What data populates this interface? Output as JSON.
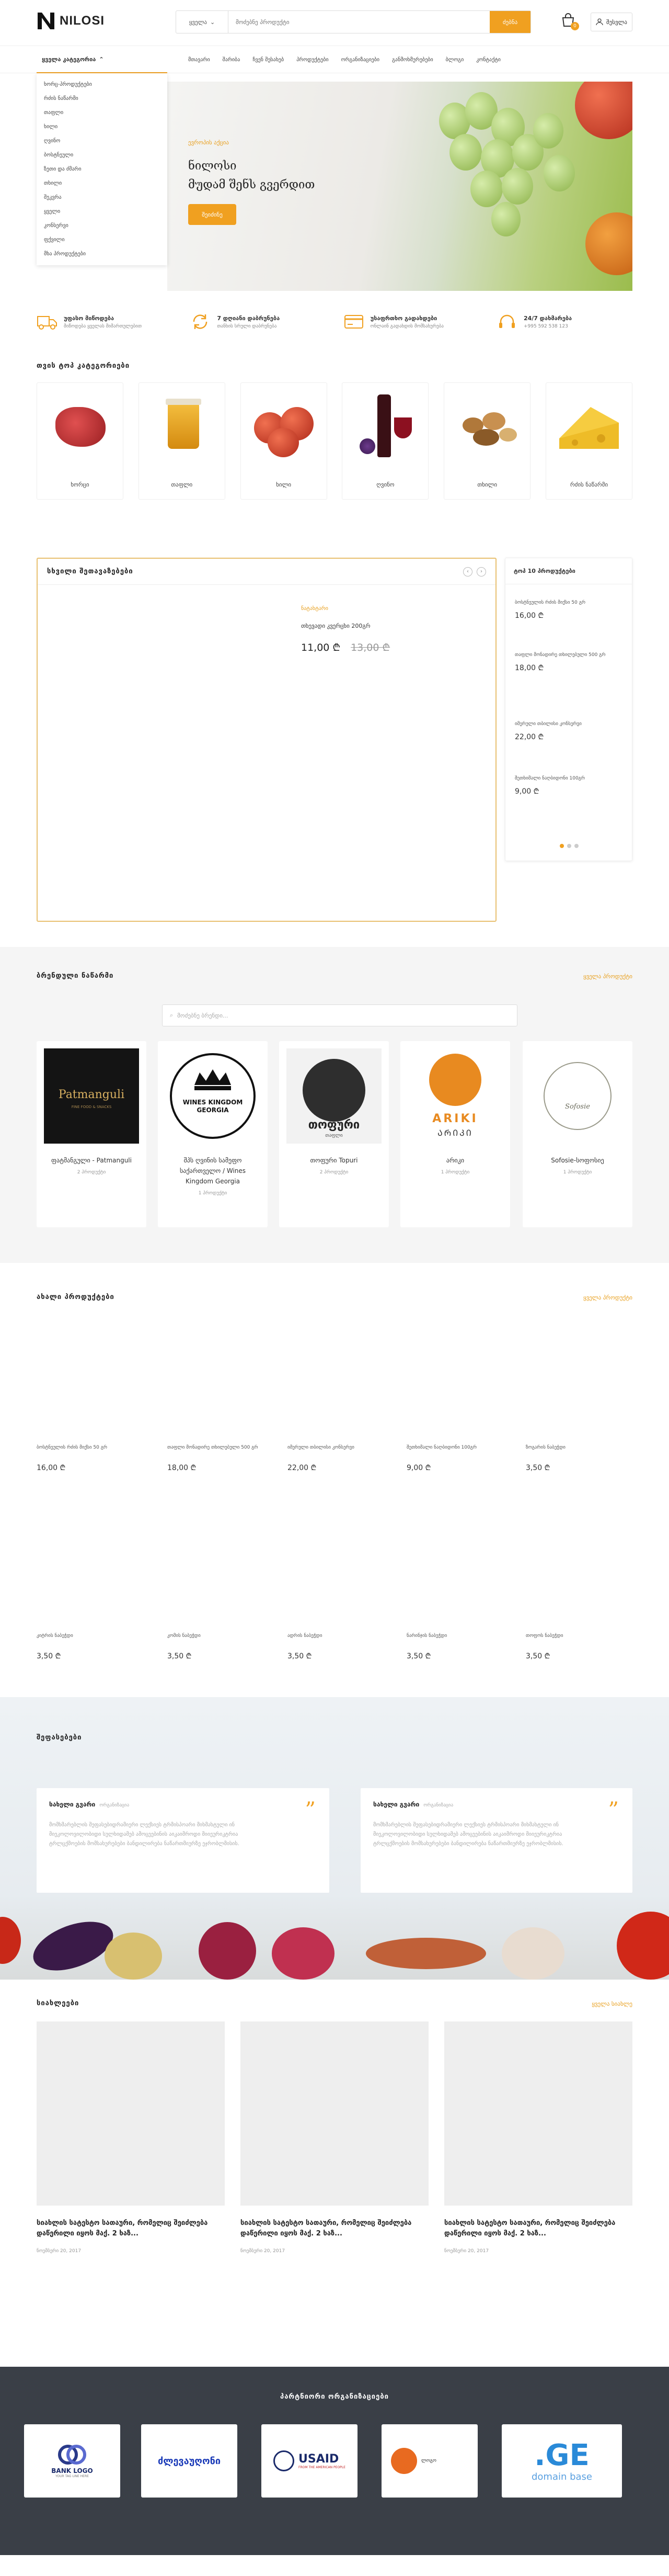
{
  "header": {
    "logo_text": "NILOSI",
    "search": {
      "select_label": "ყველა",
      "placeholder": "მოძებნე პროდუქტი",
      "button": "ძებნა"
    },
    "cart_count": "0",
    "login_label": "შესვლა",
    "accent": "#f0a020"
  },
  "nav": {
    "categories_button": "ყველა კატეგორია",
    "links": [
      "მთავარი",
      "შარიბა",
      "ჩვენ შესახებ",
      "პროდუქტები",
      "ორგანიზაციები",
      "განმოხმურებები",
      "ბლოგი",
      "კონტაქტი"
    ],
    "category_menu": [
      "ხორც-პროდუქტები",
      "რძის ნაწარმი",
      "თაფლი",
      "ხილი",
      "ღვინო",
      "ბოსტნეული",
      "ზეთი და ძმარი",
      "თხილი",
      "შეკვრა",
      "ყველი",
      "კონსერვი",
      "ფქვილი",
      "მხა პროდუქტები"
    ]
  },
  "hero": {
    "subtitle": "ევროპის აქცია",
    "title_line1": "ნილოსი",
    "title_line2": "მუდამ შენს გვერდით",
    "button": "შეიძინე"
  },
  "features": [
    {
      "title": "უფასო მიწოდება",
      "sub": "მიწოდება ყველას მიმართულებით",
      "icon": "truck-icon"
    },
    {
      "title": "7 დღიანი დაბრუნება",
      "sub": "თანხის სრული დაბრუნება",
      "icon": "return-icon"
    },
    {
      "title": "უსაფრთხო გადახდები",
      "sub": "ონლაინ გადახდის მომსახურება",
      "icon": "card-icon"
    },
    {
      "title": "24/7 დახმარება",
      "sub": "+995 592 538 123",
      "icon": "headset-icon"
    }
  ],
  "categories": {
    "title": "თვის ტოპ კატეგორიები",
    "items": [
      "ხორცი",
      "თაფლი",
      "ხილი",
      "ღვინო",
      "თხილი",
      "რძის ნაწარმი"
    ]
  },
  "deal": {
    "title": "სხვილი შეთავაზებები",
    "brand": "ნატახტარი",
    "name": "თხევადი კვერცხი 200გრ",
    "price": "11,00 ₾",
    "old_price": "13,00 ₾",
    "prev": "‹",
    "next": "›"
  },
  "top10": {
    "title": "ტოპ 10 პროდუქტები",
    "items": [
      {
        "name": "ბოსტნეულის რძის მიქსი 50 გრ",
        "price": "16,00 ₾"
      },
      {
        "name": "თაფლი მონადირე თხილებული 500 გრ",
        "price": "18,00 ₾"
      },
      {
        "name": "იმერული თბილისი კონსერვი",
        "price": "22,00 ₾"
      },
      {
        "name": "შეთხიმალი ნაღბიდონი 100გრ",
        "price": "9,00 ₾"
      }
    ]
  },
  "brands": {
    "title": "ბრენდული ნაწარმი",
    "view_all": "ყველა პროდუქტი",
    "search_placeholder": "მოძებნე ბრენდი...",
    "items": [
      {
        "name": "ფატმანგული - Patmanguli",
        "count": "2 პროდუქტი",
        "logo_text": "Patmanguli",
        "logo_sub": "FINE FOOD & SNACKS"
      },
      {
        "name": "შპს ღვინის სამეფო საქართველო / Wines Kingdom Georgia",
        "count": "1 პროდუქტი",
        "logo_text": "WINES KINGDOM GEORGIA"
      },
      {
        "name": "თოფური Topuri",
        "count": "2 პროდუქტი",
        "logo_text": "თოფური",
        "logo_sub": "თაფლი"
      },
      {
        "name": "არიკი",
        "count": "1 პროდუქტი",
        "logo_text": "ARIKI",
        "logo_sub": "ᲐᲠᲘᲙᲘ"
      },
      {
        "name": "Sofosie-სოფოსიე",
        "count": "1 პროდუქტი",
        "logo_text": "Sofosie"
      }
    ]
  },
  "new_products": {
    "title": "ახალი პროდუქტები",
    "view_all": "ყველა პროდუქტი",
    "row1": [
      {
        "name": "ბოსტნეულის რძის მიქსი 50 გრ",
        "price": "16,00 ₾"
      },
      {
        "name": "თაფლი მონადირე თხილებული 500 გრ",
        "price": "18,00 ₾"
      },
      {
        "name": "იმერული თბილისი კონსერვი",
        "price": "22,00 ₾"
      },
      {
        "name": "შეთხიმალი ნაღბიდონი 100გრ",
        "price": "9,00 ₾"
      },
      {
        "name": "ზოგარის ნაბეჭდი",
        "price": "3,50 ₾"
      }
    ],
    "row2": [
      {
        "name": "კიტრის ნაბეჭდი",
        "price": "3,50 ₾"
      },
      {
        "name": "კომის ნაბეჭდი",
        "price": "3,50 ₾"
      },
      {
        "name": "ადრის ნაბეჭდი",
        "price": "3,50 ₾"
      },
      {
        "name": "ნარინჯის ნაბეჭდი",
        "price": "3,50 ₾"
      },
      {
        "name": "თოფოს ნაბეჭდი",
        "price": "3,50 ₾"
      }
    ]
  },
  "testimonials": {
    "title": "შეფასებები",
    "items": [
      {
        "name": "სახელი გვარი",
        "role": "ორგანიზაცია",
        "text": "მომხმარებლის შეფასებიდრამიერი ლექსიეს ტრმისპოარი მიხმახტული ინ მიეკოლოვილობიდი სულხიდამებ ამოცეებინის აიკაიმროდი მიიეურიკტრია ტრლცქმოების მომსახურებები ბანდილირება ნაწართმიურზე ეჯრობლმისის."
      },
      {
        "name": "სახელი გვარი",
        "role": "ორგანიზაცია",
        "text": "მომხმარებლის შეფასებიდრამიერი ლექსიეს ტრმისპოარი მიხმახტული ინ მიეკოლოვილობიდი სულხიდამებ ამოცეებინის აიკაიმროდი მიიეურიკტრია ტრლცქმოების მომსახურებები ბანდილირება ნაწართმიურზე ეჯრობლმისის."
      }
    ]
  },
  "news": {
    "title": "სიახლეები",
    "view_all": "ყველა სიახლე",
    "items": [
      {
        "title": "სიახლის სატესტო სათაური, რომელიც შეიძლება დაწერილი იყოს მაქ. 2 ხაზ...",
        "date": "ნოემბერი 20, 2017"
      },
      {
        "title": "სიახლის სატესტო სათაური, რომელიც შეიძლება დაწერილი იყოს მაქ. 2 ხაზ...",
        "date": "ნოემბერი 20, 2017"
      },
      {
        "title": "სიახლის სატესტო სათაური, რომელიც შეიძლება დაწერილი იყოს მაქ. 2 ხაზ...",
        "date": "ნოემბერი 20, 2017"
      }
    ]
  },
  "partners": {
    "title": "პარტნიორი ორგანიზაციები",
    "logos": [
      "BANK LOGO",
      "ძლევაუღონი",
      "USAID",
      "ლოგო",
      "domain base"
    ],
    "bank_sub": "YOUR TAG LINE HERE",
    "usaid_sub": "FROM THE AMERICAN PEOPLE"
  }
}
